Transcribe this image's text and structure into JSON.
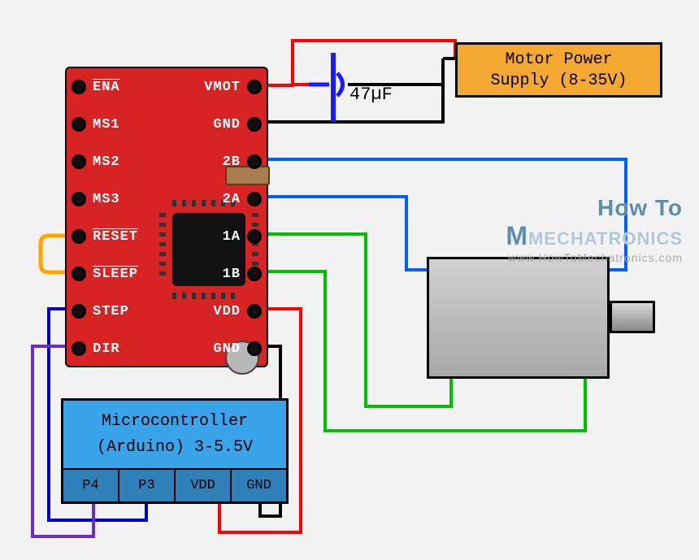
{
  "driver": {
    "left_pins": [
      "ENA",
      "MS1",
      "MS2",
      "MS3",
      "RESET",
      "SLEEP",
      "STEP",
      "DIR"
    ],
    "left_overline": {
      "0": true,
      "4": true,
      "5": true
    },
    "right_pins": [
      "VMOT",
      "GND",
      "2B",
      "2A",
      "1A",
      "1B",
      "VDD",
      "GND"
    ]
  },
  "capacitor": {
    "label": "47µF"
  },
  "psu": {
    "line1": "Motor Power",
    "line2": "Supply (8-35V)"
  },
  "mcu": {
    "line1": "Microcontroller",
    "line2": "(Arduino) 3-5.5V",
    "pins": [
      "P4",
      "P3",
      "VDD",
      "GND"
    ]
  },
  "watermark": {
    "brand_pre": "How To",
    "brand_main": "MECHATRONICS",
    "url": "www.HowToMechatronics.com"
  },
  "colors": {
    "driver_bg": "#d72323",
    "psu_bg": "#f4a832",
    "mcu_bg": "#3aa4eb",
    "wire_vmot": "#ff0000",
    "wire_gnd": "#000000",
    "wire_1a": "#00c000",
    "wire_1b": "#00c000",
    "wire_2a": "#0060ff",
    "wire_2b": "#0060ff",
    "wire_vdd": "#ff0000",
    "wire_step": "#0000c0",
    "wire_dir": "#6a2fc2",
    "wire_reset_sleep": "#ffa500",
    "cap": "#1a1aff"
  }
}
